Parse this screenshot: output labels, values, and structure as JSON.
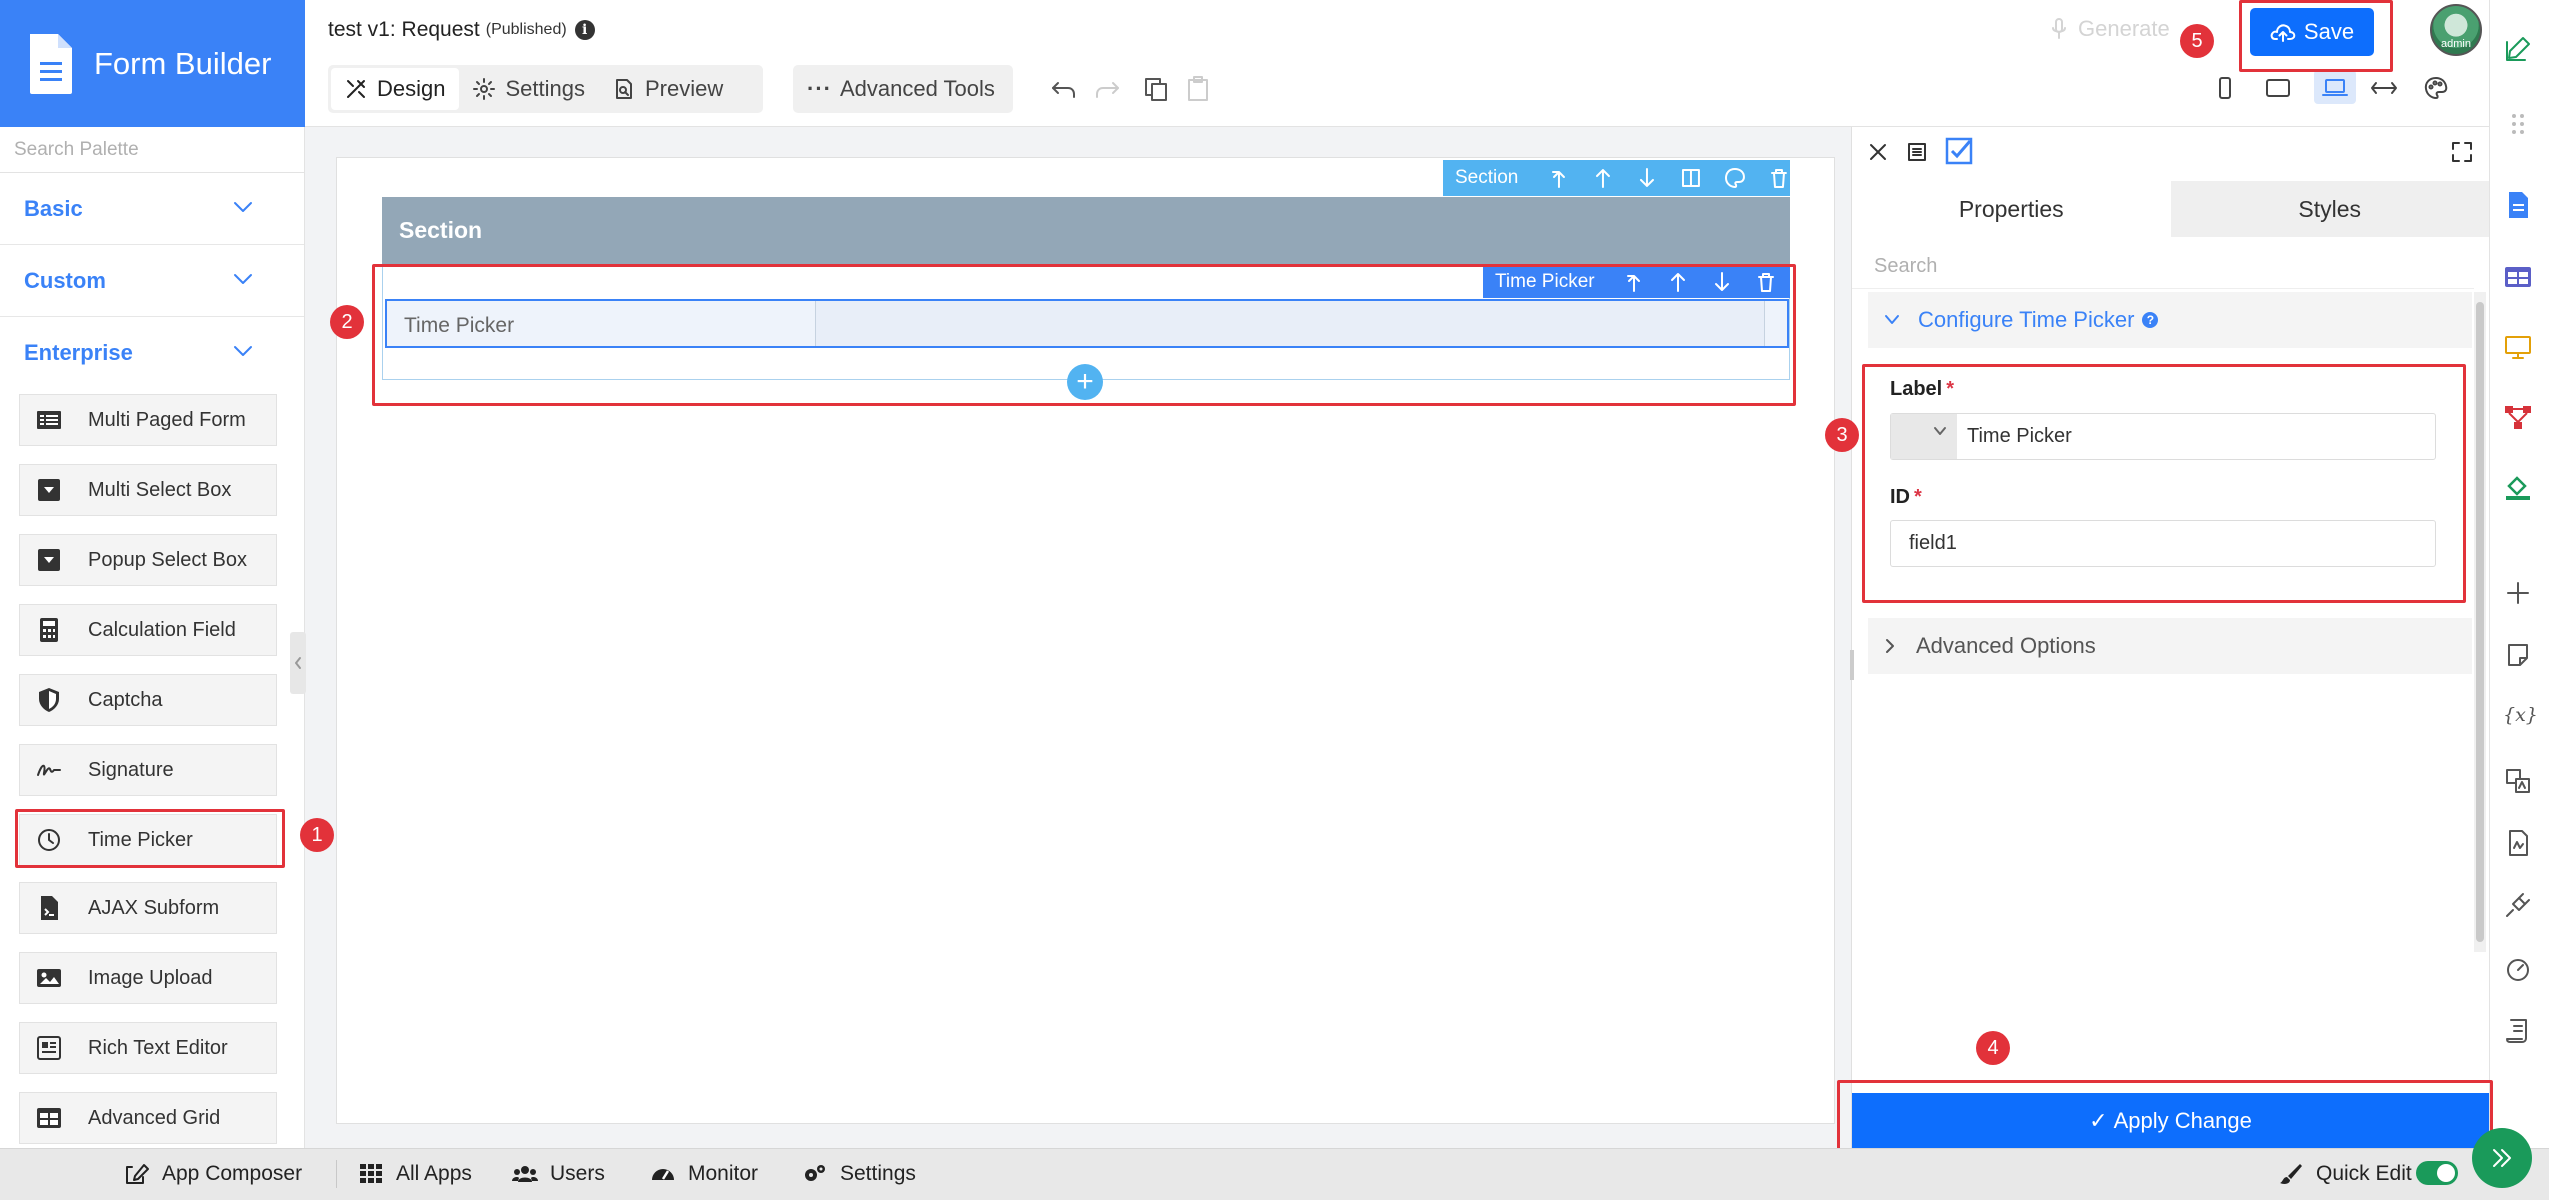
{
  "brand": {
    "title": "Form Builder"
  },
  "palette": {
    "search_placeholder": "Search Palette",
    "categories": [
      "Basic",
      "Custom",
      "Enterprise"
    ],
    "items": [
      "Multi Paged Form",
      "Multi Select Box",
      "Popup Select Box",
      "Calculation Field",
      "Captcha",
      "Signature",
      "Time Picker",
      "AJAX Subform",
      "Image Upload",
      "Rich Text Editor",
      "Advanced Grid"
    ]
  },
  "header": {
    "title": "test v1: Request",
    "status": "(Published)",
    "info_glyph": "i",
    "tabs": [
      "Design",
      "Settings",
      "Preview"
    ],
    "advanced_tools": "Advanced Tools",
    "generate": "Generate",
    "save": "Save",
    "avatar_label": "admin"
  },
  "canvas": {
    "section_toolbar_label": "Section",
    "section_title": "Section",
    "field_toolbar_label": "Time Picker",
    "field_label": "Time Picker",
    "add_glyph": "+"
  },
  "properties": {
    "tabs": [
      "Properties",
      "Styles"
    ],
    "search_placeholder": "Search",
    "configure_title": "Configure Time Picker",
    "help_glyph": "?",
    "label_field": {
      "label": "Label",
      "required_mark": "*",
      "value": "Time Picker"
    },
    "id_field": {
      "label": "ID",
      "required_mark": "*",
      "value": "field1"
    },
    "advanced_options": "Advanced Options",
    "apply_button": "Apply Change",
    "apply_check": "✓"
  },
  "annotations": [
    "1",
    "2",
    "3",
    "4",
    "5"
  ],
  "bottombar": {
    "items": [
      "App Composer",
      "All Apps",
      "Users",
      "Monitor",
      "Settings"
    ],
    "quick_edit": "Quick Edit"
  },
  "colors": {
    "brand": "#3a82f7",
    "primary_button": "#0d6efd",
    "annotation_red": "#e2323a",
    "section_header": "#93a7b7",
    "toggle_on": "#1a9a5a"
  }
}
